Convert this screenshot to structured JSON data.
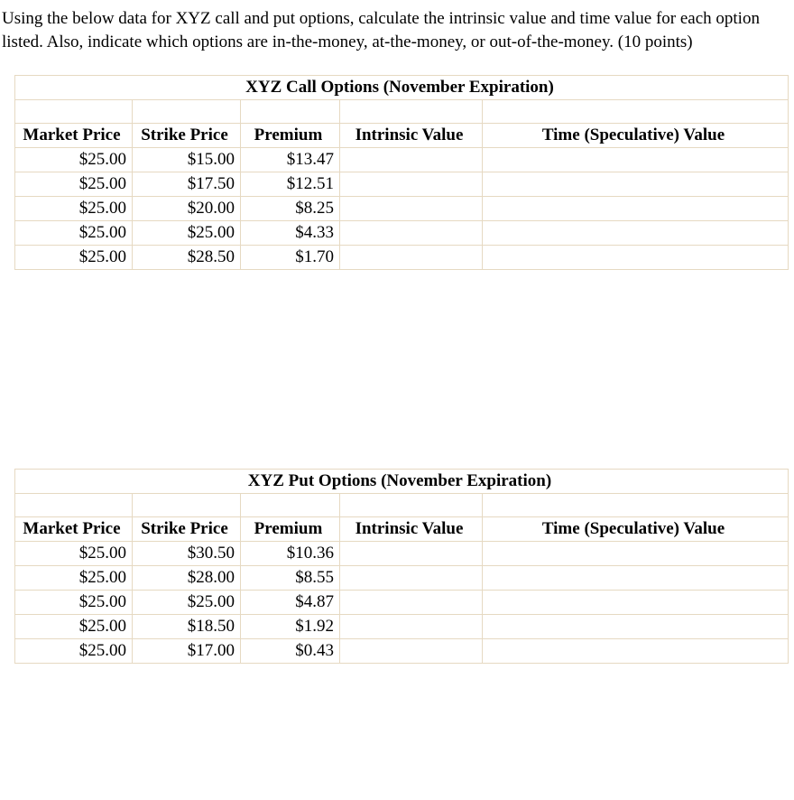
{
  "question": "Using the below data for XYZ call and put options, calculate the intrinsic value and time value for each option listed.  Also, indicate which options are in-the-money, at-the-money, or out-of-the-money.  (10 points)",
  "tables": {
    "calls": {
      "title": "XYZ Call Options (November Expiration)",
      "headers": [
        "Market Price",
        "Strike Price",
        "Premium",
        "Intrinsic Value",
        "Time (Speculative) Value"
      ],
      "rows": [
        {
          "market": "$25.00",
          "strike": "$15.00",
          "premium": "$13.47",
          "intrinsic": "",
          "time": ""
        },
        {
          "market": "$25.00",
          "strike": "$17.50",
          "premium": "$12.51",
          "intrinsic": "",
          "time": ""
        },
        {
          "market": "$25.00",
          "strike": "$20.00",
          "premium": "$8.25",
          "intrinsic": "",
          "time": ""
        },
        {
          "market": "$25.00",
          "strike": "$25.00",
          "premium": "$4.33",
          "intrinsic": "",
          "time": ""
        },
        {
          "market": "$25.00",
          "strike": "$28.50",
          "premium": "$1.70",
          "intrinsic": "",
          "time": ""
        }
      ]
    },
    "puts": {
      "title": "XYZ Put Options (November Expiration)",
      "headers": [
        "Market Price",
        "Strike Price",
        "Premium",
        "Intrinsic Value",
        "Time (Speculative) Value"
      ],
      "rows": [
        {
          "market": "$25.00",
          "strike": "$30.50",
          "premium": "$10.36",
          "intrinsic": "",
          "time": ""
        },
        {
          "market": "$25.00",
          "strike": "$28.00",
          "premium": "$8.55",
          "intrinsic": "",
          "time": ""
        },
        {
          "market": "$25.00",
          "strike": "$25.00",
          "premium": "$4.87",
          "intrinsic": "",
          "time": ""
        },
        {
          "market": "$25.00",
          "strike": "$18.50",
          "premium": "$1.92",
          "intrinsic": "",
          "time": ""
        },
        {
          "market": "$25.00",
          "strike": "$17.00",
          "premium": "$0.43",
          "intrinsic": "",
          "time": ""
        }
      ]
    }
  },
  "chart_data": [
    {
      "type": "table",
      "title": "XYZ Call Options (November Expiration)",
      "columns": [
        "Market Price",
        "Strike Price",
        "Premium",
        "Intrinsic Value",
        "Time (Speculative) Value"
      ],
      "rows": [
        [
          25.0,
          15.0,
          13.47,
          null,
          null
        ],
        [
          25.0,
          17.5,
          12.51,
          null,
          null
        ],
        [
          25.0,
          20.0,
          8.25,
          null,
          null
        ],
        [
          25.0,
          25.0,
          4.33,
          null,
          null
        ],
        [
          25.0,
          28.5,
          1.7,
          null,
          null
        ]
      ]
    },
    {
      "type": "table",
      "title": "XYZ Put Options (November Expiration)",
      "columns": [
        "Market Price",
        "Strike Price",
        "Premium",
        "Intrinsic Value",
        "Time (Speculative) Value"
      ],
      "rows": [
        [
          25.0,
          30.5,
          10.36,
          null,
          null
        ],
        [
          25.0,
          28.0,
          8.55,
          null,
          null
        ],
        [
          25.0,
          25.0,
          4.87,
          null,
          null
        ],
        [
          25.0,
          18.5,
          1.92,
          null,
          null
        ],
        [
          25.0,
          17.0,
          0.43,
          null,
          null
        ]
      ]
    }
  ]
}
